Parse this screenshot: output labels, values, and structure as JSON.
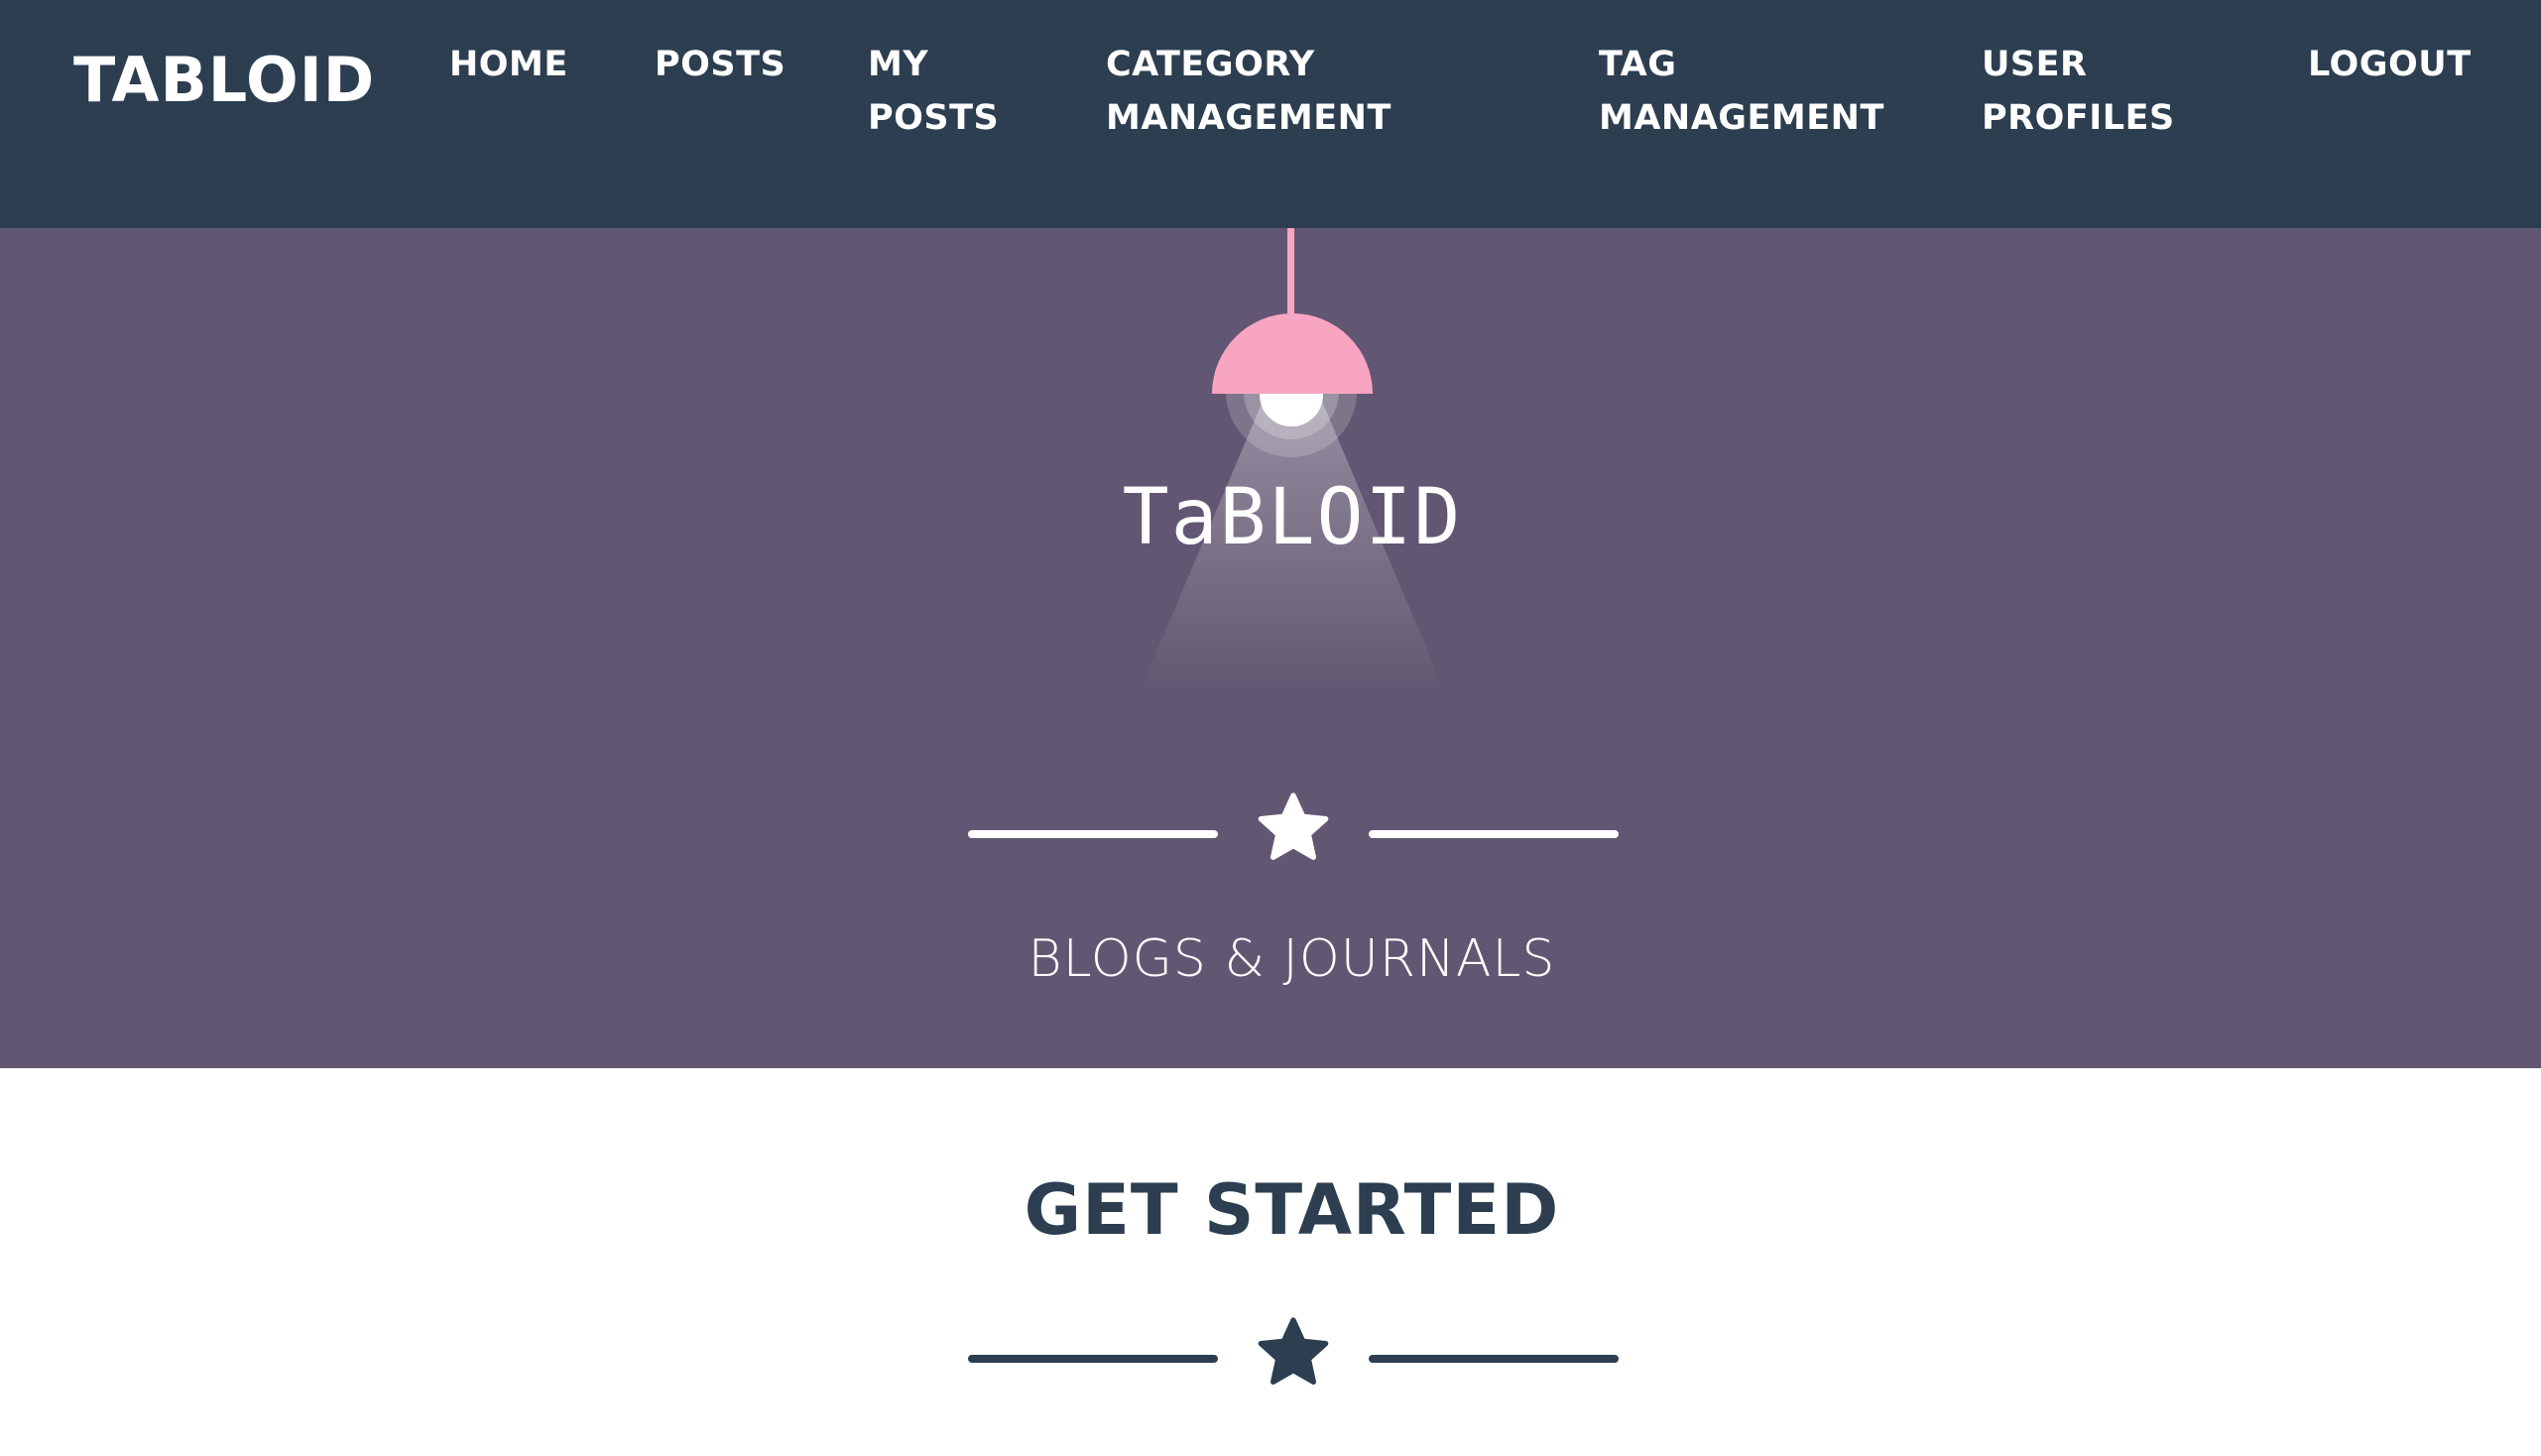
{
  "navbar": {
    "brand": "TABLOID",
    "links": [
      {
        "label": "HOME"
      },
      {
        "label": "POSTS"
      },
      {
        "label": "MY\nPOSTS"
      },
      {
        "label": "CATEGORY\nMANAGEMENT"
      },
      {
        "label": "TAG\nMANAGEMENT"
      },
      {
        "label": "USER\nPROFILES"
      },
      {
        "label": "LOGOUT"
      }
    ]
  },
  "masthead": {
    "logo_text": "TaBLOID",
    "subtitle": "BLOGS & JOURNALS",
    "lamp_shade_color": "#f8a5c2"
  },
  "section": {
    "heading": "GET STARTED"
  },
  "colors": {
    "navbar_bg": "#2c3e50",
    "masthead_bg": "#625772",
    "lamp_pink": "#f8a5c2",
    "heading_dark": "#2c3e50",
    "white": "#ffffff"
  },
  "icons": {
    "divider_icon": "star-icon",
    "lamp_icon": "lamp-icon"
  }
}
